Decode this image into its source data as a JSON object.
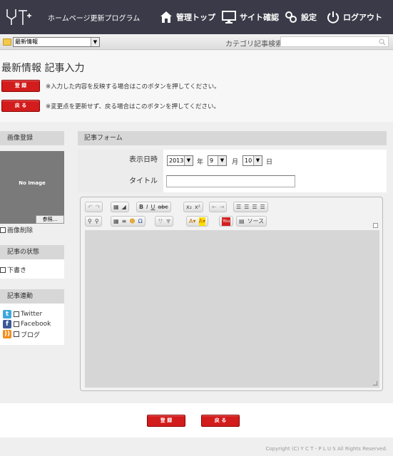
{
  "header": {
    "site_title": "ホームページ更新プログラム",
    "nav": {
      "top": "管理トップ",
      "site": "サイト確認",
      "settings": "設定",
      "logout": "ログアウト"
    }
  },
  "catbar": {
    "category_value": "最新情報",
    "search_label": "カテゴリ記事検索",
    "search_placeholder": ""
  },
  "page": {
    "title": "最新情報 記事入力",
    "register_label": "登 録",
    "back_label": "戻 る",
    "register_hint": "※入力した内容を反映する場合はこのボタンを押してください。",
    "back_hint": "※変更点を更新せず、戻る場合はこのボタンを押してください。"
  },
  "sidebar": {
    "image_heading": "画像登録",
    "no_image": "No Image",
    "browse_label": "参照...",
    "delete_image": "画像削除",
    "status_heading": "記事の状態",
    "draft": "下書き",
    "link_heading": "記事連動",
    "sns": [
      "Twitter",
      "Facebook",
      "ブログ"
    ]
  },
  "form": {
    "heading": "記事フォーム",
    "date_label": "表示日時",
    "year": "2013",
    "year_unit": "年",
    "month": "9",
    "month_unit": "月",
    "day": "10",
    "day_unit": "日",
    "title_label": "タイトル",
    "title_value": ""
  },
  "editor": {
    "source_label": "ソース"
  },
  "footer": {
    "register_label": "登 録",
    "back_label": "戻 る",
    "copyright": "Copyright (C) Y C T - P L U S All Rights Reserved."
  }
}
